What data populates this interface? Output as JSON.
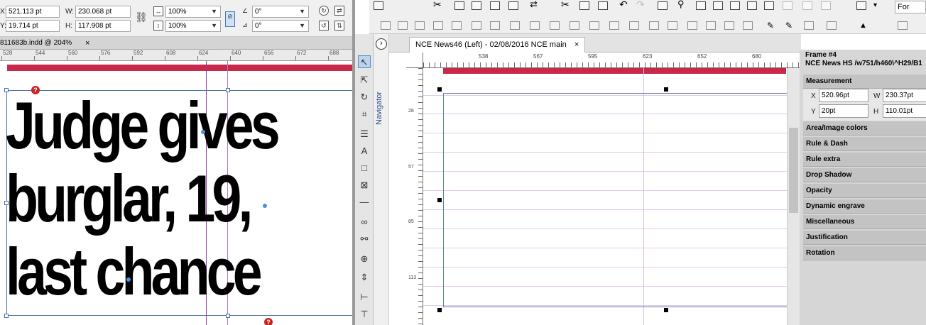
{
  "left_panel": {
    "control": {
      "x_label": "X:",
      "x_value": "521.113 pt",
      "y_label": "Y:",
      "y_value": "19.714 pt",
      "w_label": "W:",
      "w_value": "230.068 pt",
      "h_label": "H:",
      "h_value": "117.908 pt",
      "scale_x": "100%",
      "scale_y": "100%",
      "rotate": "0°",
      "shear": "0°"
    },
    "doc_tab": "811683b.indd @ 204%",
    "ruler_labels": [
      "528",
      "544",
      "560",
      "576",
      "592",
      "608",
      "624",
      "640",
      "656",
      "672",
      "688"
    ],
    "headline_lines": [
      "Judge gives",
      "burglar, 19,",
      "last chance"
    ],
    "overset_marker": "?"
  },
  "right_panel": {
    "font_field": "For",
    "window_tab": "NCE News46 (Left) - 02/08/2016 NCE main",
    "tab_close": "×",
    "navigator_label": "Navigator",
    "navigator_toggle": "›",
    "hruler_labels": [
      "538",
      "567",
      "595",
      "623",
      "652",
      "680"
    ],
    "vruler_labels": [
      "28",
      "57",
      "85",
      "113"
    ],
    "props": {
      "frame_title": "Frame #4",
      "frame_style": "NCE News HS /w751/h460\\^H29/B1",
      "measurement_label": "Measurement",
      "x_label": "X",
      "x_value": "520.96pt",
      "w_label": "W",
      "w_value": "230.37pt",
      "y_label": "Y",
      "y_value": "20pt",
      "h_label": "H",
      "h_value": "110.01pt",
      "sections": [
        "Area/Image colors",
        "Rule & Dash",
        "Rule extra",
        "Drop Shadow",
        "Opacity",
        "Dynamic engrave",
        "Miscellaneous",
        "Justification",
        "Rotation"
      ]
    }
  },
  "colors": {
    "accent_red": "#c8284a",
    "frame_blue": "#4a6fa5",
    "guide_purple": "#8a3d9e",
    "grid_pink": "#e2c9ee",
    "selection_dot": "#4a90e2"
  }
}
